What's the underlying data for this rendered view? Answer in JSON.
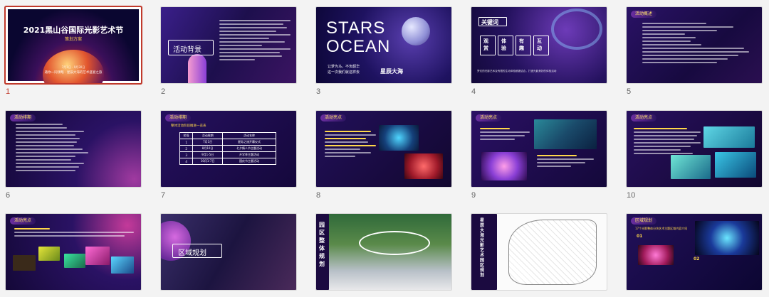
{
  "slides": [
    {
      "num": "1",
      "title": "2021黑山谷国际光影艺术节",
      "subtitle": "策划方案",
      "meta": "7月1日 - 9月30日",
      "tagline": "邀你一同领略 · 星辰大海的艺术盛宴之旅"
    },
    {
      "num": "2",
      "title": "活动背景"
    },
    {
      "num": "3",
      "title_line1": "STARS",
      "title_line2": "OCEAN",
      "text_line1": "让梦为马，不负韶华",
      "text_line2": "这一次我们就这样去",
      "highlight": "星辰大海"
    },
    {
      "num": "4",
      "keyword": "关键词",
      "words": [
        "观赏",
        "体验",
        "有趣",
        "互动"
      ],
      "footer": "梦幻的光影艺术及有限的生动体验都被结合，打造光影美妙的体验活动"
    },
    {
      "num": "5",
      "title": "活动概述"
    },
    {
      "num": "6",
      "title": "活动排期"
    },
    {
      "num": "7",
      "title": "活动排期",
      "caption": "整体活动阶段推进一览表",
      "table_headers": [
        "阶段",
        "活动周期",
        "活动名称"
      ],
      "table_rows": [
        [
          "1",
          "7月1日",
          "星际之旅开幕仪式"
        ],
        [
          "2",
          "8月10日",
          "七夕情人节主题活动"
        ],
        [
          "3",
          "9月1-5日",
          "开学季主题活动"
        ],
        [
          "4",
          "10月1-7日",
          "国庆节主题活动"
        ]
      ]
    },
    {
      "num": "8",
      "title": "活动亮点"
    },
    {
      "num": "9",
      "title": "活动亮点"
    },
    {
      "num": "10",
      "title": "活动亮点"
    },
    {
      "num": "11",
      "title": "活动亮点"
    },
    {
      "num": "12",
      "title": "区域规划"
    },
    {
      "num": "13",
      "title": "园区整体规划"
    },
    {
      "num": "14",
      "title": "星辰大海光影艺术园区规划"
    },
    {
      "num": "15",
      "title": "区域规划",
      "caption": "17个光影整体分块艺术主题区域内容介绍",
      "label1": "01",
      "label2": "02"
    }
  ]
}
